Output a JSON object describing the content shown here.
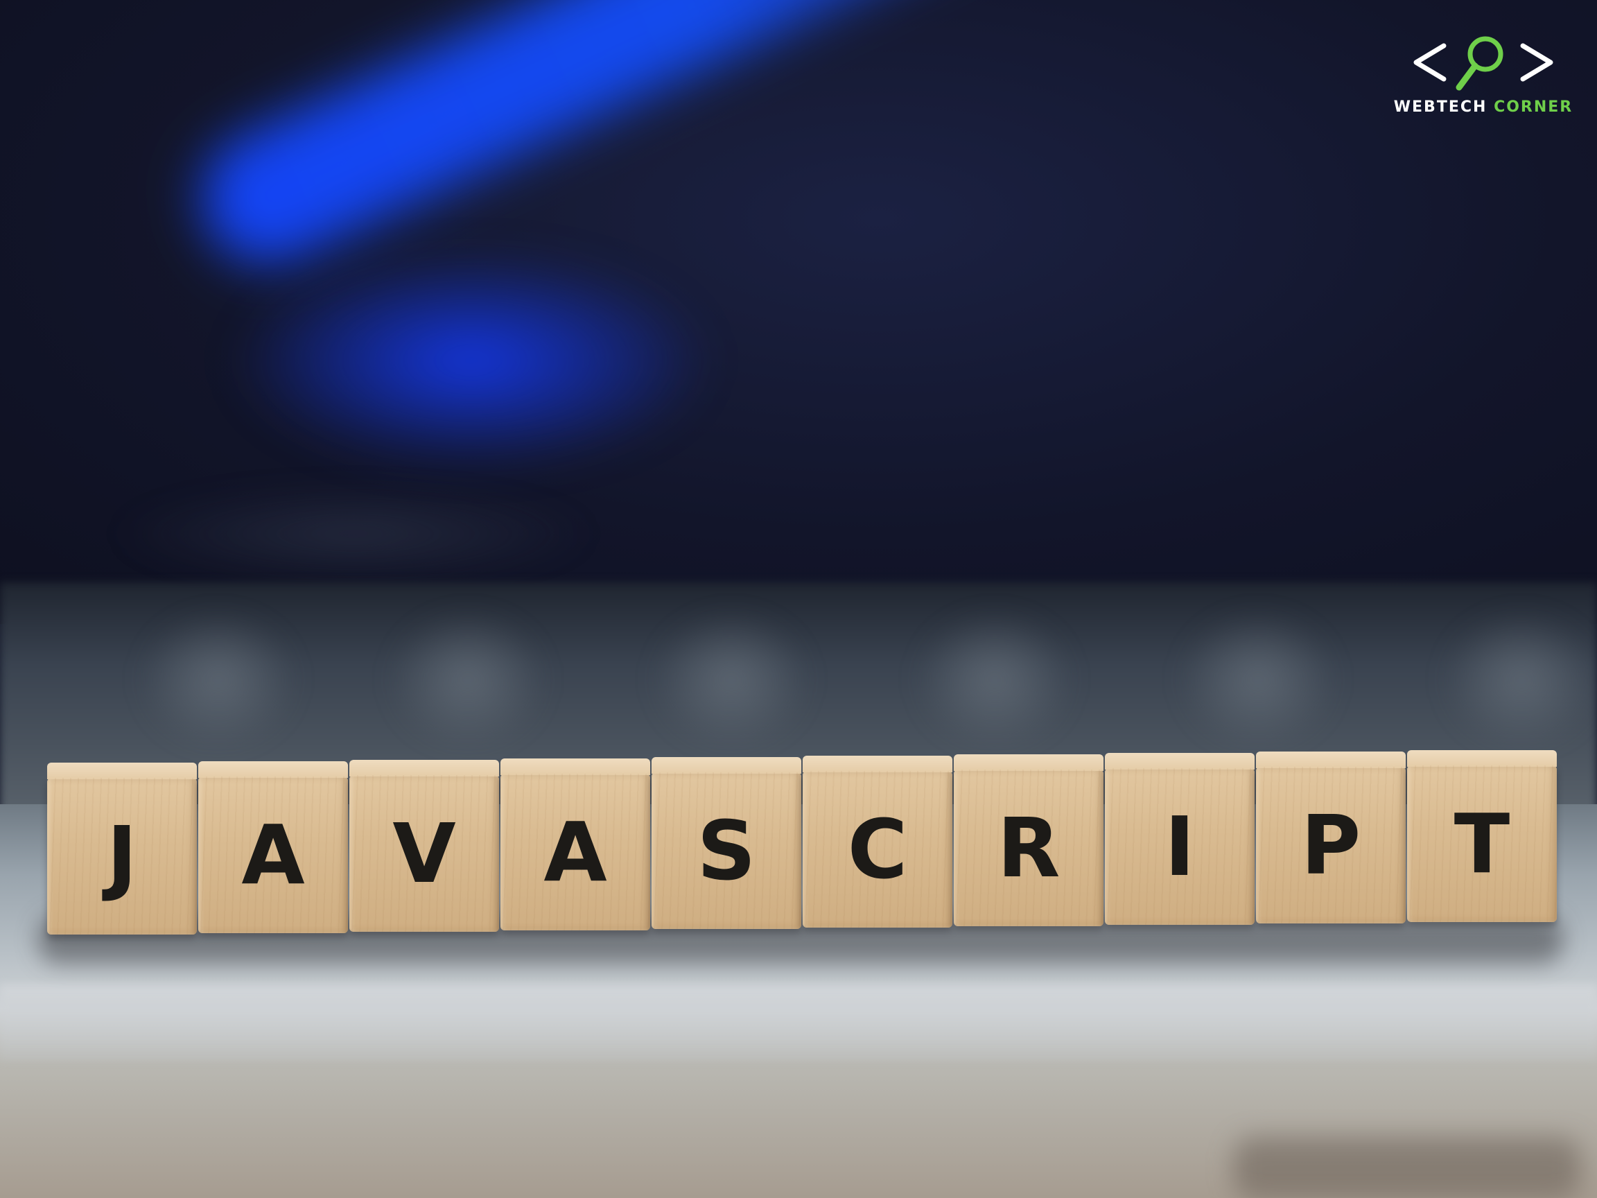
{
  "logo": {
    "word_1": "WEBTECH",
    "word_2": "CORNER",
    "bracket_color": "#ffffff",
    "accent_color": "#6fcf4a"
  },
  "blocks": {
    "letters": [
      "J",
      "A",
      "V",
      "A",
      "S",
      "C",
      "R",
      "I",
      "P",
      "T"
    ]
  },
  "colors": {
    "background_screen": "#12152a",
    "streak_blue": "#1450ff",
    "wood": "#d9bb91",
    "letter": "#1c1a17"
  }
}
